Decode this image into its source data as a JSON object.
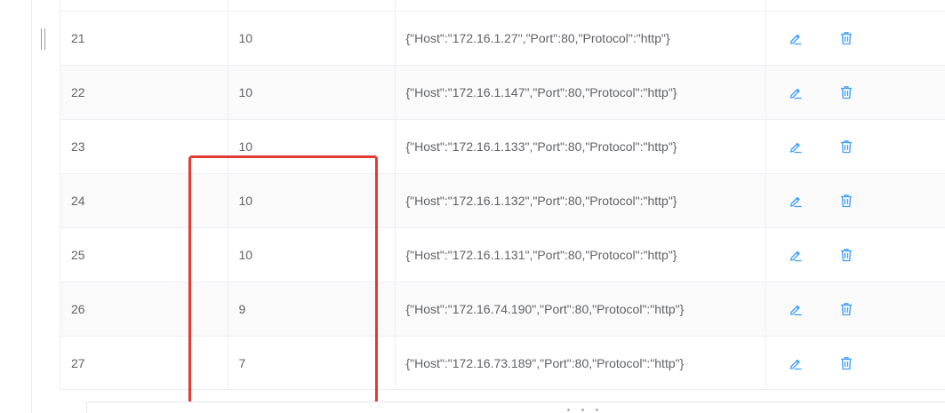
{
  "icons": {
    "edit": "edit-icon",
    "delete": "delete-icon",
    "accent_color": "#409eff"
  },
  "highlight_color": "#e53935",
  "rows": [
    {
      "id": "21",
      "weight": "10",
      "config": "{\"Host\":\"172.16.1.27\",\"Port\":80,\"Protocol\":\"http\"}"
    },
    {
      "id": "22",
      "weight": "10",
      "config": "{\"Host\":\"172.16.1.147\",\"Port\":80,\"Protocol\":\"http\"}"
    },
    {
      "id": "23",
      "weight": "10",
      "config": "{\"Host\":\"172.16.1.133\",\"Port\":80,\"Protocol\":\"http\"}"
    },
    {
      "id": "24",
      "weight": "10",
      "config": "{\"Host\":\"172.16.1.132\",\"Port\":80,\"Protocol\":\"http\"}"
    },
    {
      "id": "25",
      "weight": "10",
      "config": "{\"Host\":\"172.16.1.131\",\"Port\":80,\"Protocol\":\"http\"}"
    },
    {
      "id": "26",
      "weight": "9",
      "config": "{\"Host\":\"172.16.74.190\",\"Port\":80,\"Protocol\":\"http\"}"
    },
    {
      "id": "27",
      "weight": "7",
      "config": "{\"Host\":\"172.16.73.189\",\"Port\":80,\"Protocol\":\"http\"}"
    }
  ]
}
